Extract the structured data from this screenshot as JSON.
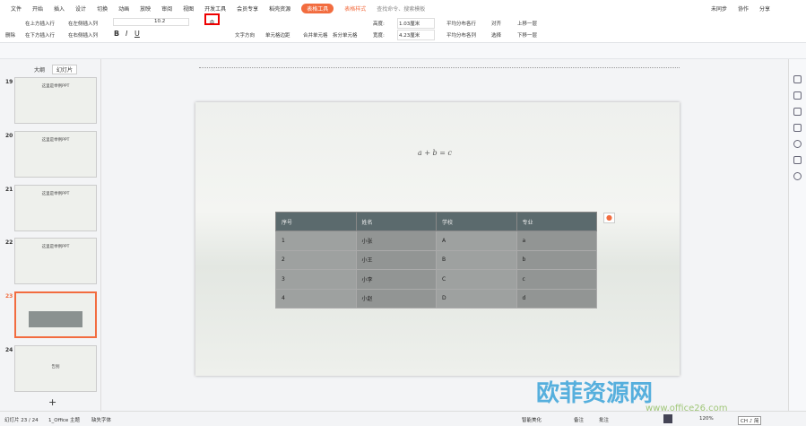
{
  "menu": {
    "file": "文件",
    "tabs": [
      "开始",
      "插入",
      "设计",
      "切换",
      "动画",
      "放映",
      "审阅",
      "视图",
      "开发工具",
      "会员专享",
      "稻壳资源"
    ],
    "table_tools": "表格工具",
    "table_style": "表格样式",
    "search": "查找命令、搜索模板",
    "sync": "未同步",
    "collab": "协作",
    "share": "分享"
  },
  "ribbon": {
    "delete": "删除",
    "insert_above": "在上方插入行",
    "insert_below": "在下方插入行",
    "insert_left": "在左侧插入列",
    "insert_right": "在右侧插入列",
    "font_size": "10.2",
    "text_dir": "文字方向",
    "cell_margin": "单元格边距",
    "merge": "合并单元格",
    "split": "拆分单元格",
    "height_label": "高度:",
    "height_value": "1.03厘米",
    "width_label": "宽度:",
    "width_value": "4.23厘米",
    "dist_rows": "平均分布各行",
    "dist_cols": "平均分布各列",
    "align": "对齐",
    "select": "选择",
    "bring_forward": "上移一层",
    "send_backward": "下移一层"
  },
  "panel": {
    "tab_outline": "大纲",
    "tab_slides": "幻灯片",
    "slides": [
      {
        "num": "19",
        "title": "这里是举例PPT"
      },
      {
        "num": "20",
        "title": "这里是举例PPT"
      },
      {
        "num": "21",
        "title": "这里是举例PPT"
      },
      {
        "num": "22",
        "title": "这里是举例PPT"
      },
      {
        "num": "23",
        "title": ""
      },
      {
        "num": "24",
        "title": "告别"
      }
    ]
  },
  "slide": {
    "formula": "a + b = c",
    "table": {
      "headers": [
        "序号",
        "姓名",
        "学校",
        "专业"
      ],
      "rows": [
        [
          "1",
          "小张",
          "A",
          "a"
        ],
        [
          "2",
          "小王",
          "B",
          "b"
        ],
        [
          "3",
          "小李",
          "C",
          "c"
        ],
        [
          "4",
          "小赵",
          "D",
          "d"
        ]
      ]
    }
  },
  "status": {
    "slide_pos": "幻灯片 23 / 24",
    "theme": "1_Office 主题",
    "missing_font": "缺失字体",
    "smart": "智能美化",
    "notes": "备注",
    "comment": "批注",
    "zoom": "120%",
    "ime": "CH ♪ 简"
  },
  "watermark": {
    "text": "欧菲资源网",
    "url": "www.office26.com"
  }
}
